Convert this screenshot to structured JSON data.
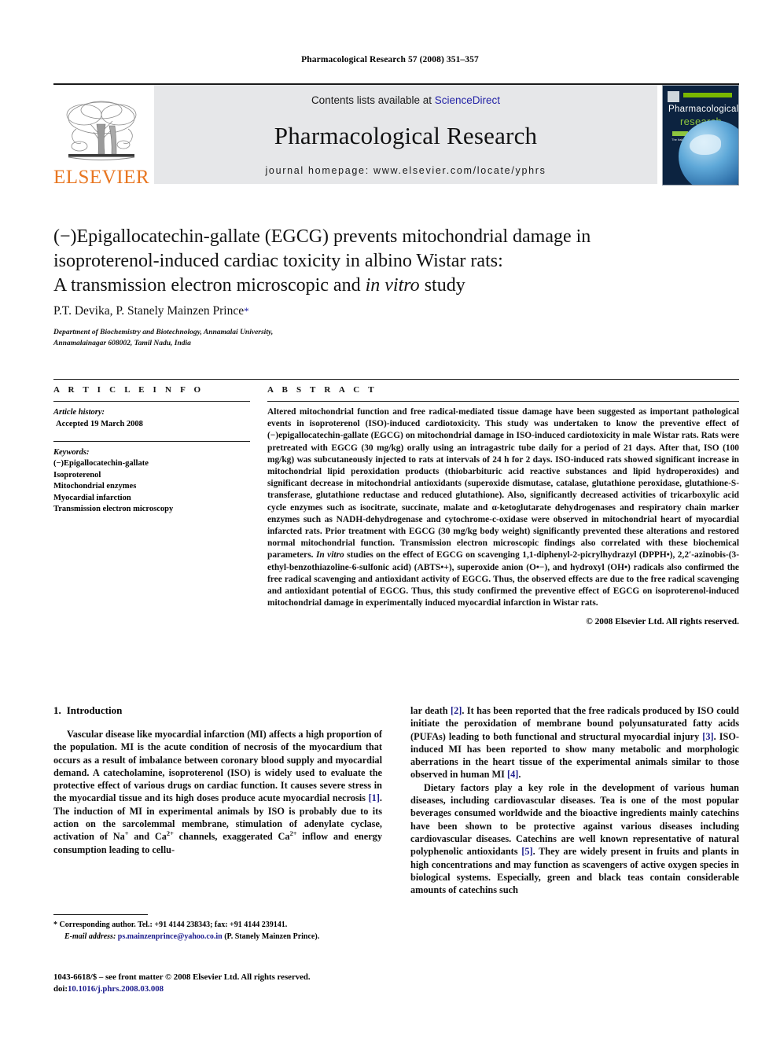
{
  "running_head": "Pharmacological Research 57 (2008) 351–357",
  "masthead": {
    "contents_prefix": "Contents lists available at ",
    "sciencedirect": "ScienceDirect",
    "journal_title": "Pharmacological Research",
    "homepage": "journal homepage: www.elsevier.com/locate/yphrs",
    "publisher_logo_text": "ELSEVIER",
    "cover": {
      "line1": "Pharmacological",
      "line2": "research",
      "small_text": "The Italian Pharmacological Society"
    },
    "colors": {
      "band": "#e6e7e9",
      "link": "#2323a6",
      "elsevier_orange": "#e87722",
      "cover_navy": "#0c2340",
      "cover_green": "#7ab800"
    }
  },
  "article": {
    "title_line1": "(−)Epigallocatechin-gallate (EGCG) prevents mitochondrial damage in",
    "title_line2": "isoproterenol-induced cardiac toxicity in albino Wistar rats:",
    "title_line3_a": "A transmission electron microscopic and ",
    "title_line3_italic": "in vitro",
    "title_line3_b": " study",
    "authors": "P.T. Devika, P. Stanely Mainzen Prince",
    "author_star": "*",
    "affiliation_line1": "Department of Biochemistry and Biotechnology, Annamalai University,",
    "affiliation_line2": "Annamalainagar 608002, Tamil Nadu, India"
  },
  "article_info": {
    "heading": "A R T I C L E   I N F O",
    "history_label": "Article history:",
    "history_value": "Accepted 19 March 2008",
    "keywords_label": "Keywords:",
    "keywords": [
      "(−)Epigallocatechin-gallate",
      "Isoproterenol",
      "Mitochondrial enzymes",
      "Myocardial infarction",
      "Transmission electron microscopy"
    ]
  },
  "abstract": {
    "heading": "A B S T R A C T",
    "part1": "Altered mitochondrial function and free radical-mediated tissue damage have been suggested as important pathological events in isoproterenol (ISO)-induced cardiotoxicity. This study was undertaken to know the preventive effect of (−)epigallocatechin-gallate (EGCG) on mitochondrial damage in ISO-induced cardiotoxicity in male Wistar rats. Rats were pretreated with EGCG (30 mg/kg) orally using an intragastric tube daily for a period of 21 days. After that, ISO (100 mg/kg) was subcutaneously injected to rats at intervals of 24 h for 2 days. ISO-induced rats showed significant increase in mitochondrial lipid peroxidation products (thiobarbituric acid reactive substances and lipid hydroperoxides) and significant decrease in mitochondrial antioxidants (superoxide dismutase, catalase, glutathione peroxidase, glutathione-S-transferase, glutathione reductase and reduced glutathione). Also, significantly decreased activities of tricarboxylic acid cycle enzymes such as isocitrate, succinate, malate and α-ketoglutarate dehydrogenases and respiratory chain marker enzymes such as NADH-dehydrogenase and cytochrome-c-oxidase were observed in mitochondrial heart of myocardial infarcted rats. Prior treatment with EGCG (30 mg/kg body weight) significantly prevented these alterations and restored normal mitochondrial function. Transmission electron microscopic findings also correlated with these biochemical parameters. ",
    "italic1": "In vitro",
    "part2": " studies on the effect of EGCG on scavenging 1,1-diphenyl-2-picrylhydrazyl (DPPH•), 2,2′-azinobis-(3-ethyl-benzothiazoline-6-sulfonic acid) (ABTS•+), superoxide anion (O•−), and hydroxyl (OH•) radicals also confirmed the free radical scavenging and antioxidant activity of EGCG. Thus, the observed effects are due to the free radical scavenging and antioxidant potential of EGCG. Thus, this study confirmed the preventive effect of EGCG on isoproterenol-induced mitochondrial damage in experimentally induced myocardial infarction in Wistar rats.",
    "copyright": "© 2008 Elsevier Ltd. All rights reserved."
  },
  "introduction": {
    "number": "1.",
    "heading": "Introduction",
    "left_p1_a": "Vascular disease like myocardial infarction (MI) affects a high proportion of the population. MI is the acute condition of necrosis of the myocardium that occurs as a result of imbalance between coronary blood supply and myocardial demand. A catecholamine, isoproterenol (ISO) is widely used to evaluate the protective effect of various drugs on cardiac function. It causes severe stress in the myocardial tissue and its high doses produce acute myocardial necrosis ",
    "left_ref1": "[1]",
    "left_p1_b": ". The induction of MI in experimental animals by ISO is probably due to its action on the sarcolemmal membrane, stimulation of adenylate cyclase, activation of Na",
    "left_sup1": "+",
    "left_p1_c": " and Ca",
    "left_sup2": "2+",
    "left_p1_d": " channels, exaggerated Ca",
    "left_sup3": "2+",
    "left_p1_e": " inflow and energy consumption leading to cellu-",
    "right_p1_a": "lar death ",
    "right_ref2": "[2]",
    "right_p1_b": ". It has been reported that the free radicals produced by ISO could initiate the peroxidation of membrane bound polyunsaturated fatty acids (PUFAs) leading to both functional and structural myocardial injury ",
    "right_ref3": "[3]",
    "right_p1_c": ". ISO-induced MI has been reported to show many metabolic and morphologic aberrations in the heart tissue of the experimental animals similar to those observed in human MI ",
    "right_ref4": "[4]",
    "right_p1_d": ".",
    "right_p2_a": "Dietary factors play a key role in the development of various human diseases, including cardiovascular diseases. Tea is one of the most popular beverages consumed worldwide and the bioactive ingredients mainly catechins have been shown to be protective against various diseases including cardiovascular diseases. Catechins are well known representative of natural polyphenolic antioxidants ",
    "right_ref5": "[5]",
    "right_p2_b": ". They are widely present in fruits and plants in high concentrations and may function as scavengers of active oxygen species in biological systems. Especially, green and black teas contain considerable amounts of catechins such"
  },
  "footnote": {
    "star": "*",
    "corresponding": " Corresponding author. Tel.: +91 4144 238343; fax: +91 4144 239141.",
    "email_label": "E-mail address:",
    "email": "ps.mainzenprince@yahoo.co.in",
    "email_suffix": " (P. Stanely Mainzen Prince)."
  },
  "imprint": {
    "line1": "1043-6618/$ – see front matter © 2008 Elsevier Ltd. All rights reserved.",
    "doi_label": "doi:",
    "doi_value": "10.1016/j.phrs.2008.03.008"
  }
}
